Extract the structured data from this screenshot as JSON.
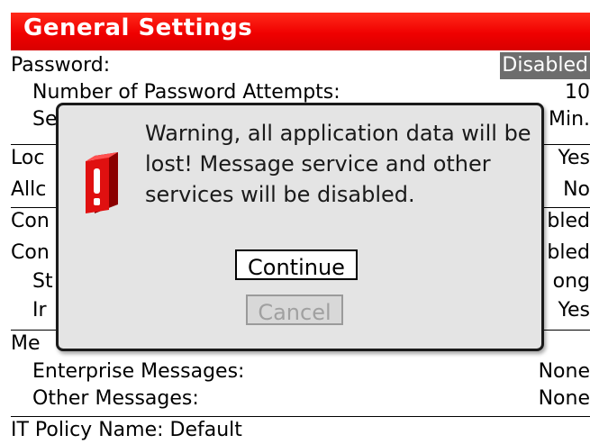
{
  "screen": {
    "title": "General Settings",
    "rows": [
      {
        "label": "Password:",
        "value": "Disabled",
        "value_highlight": true
      },
      {
        "label": "Number of Password Attempts:",
        "value": "10"
      },
      {
        "label": "Se",
        "value": "Min."
      },
      {
        "label": "Loc",
        "value": "Yes"
      },
      {
        "label": "Allc",
        "value": "No"
      },
      {
        "label": "Con",
        "value": "bled"
      },
      {
        "label": "Con",
        "value": "bled"
      },
      {
        "label": "St",
        "value": "ong"
      },
      {
        "label": "Ir",
        "value": "Yes"
      },
      {
        "label": "Me",
        "value": ""
      },
      {
        "label": "Enterprise Messages:",
        "value": "None"
      },
      {
        "label": "Other Messages:",
        "value": "None"
      },
      {
        "label": "IT Policy Name: Default",
        "value": ""
      }
    ]
  },
  "dialog": {
    "icon": "warning-exclamation-icon",
    "message": "Warning, all application data will be lost! Message service and other services will be disabled.",
    "continue_label": "Continue",
    "cancel_label": "Cancel"
  },
  "colors": {
    "title_bar": "#f00000",
    "highlight": "#6d6d6d",
    "icon_red": "#e01010"
  }
}
